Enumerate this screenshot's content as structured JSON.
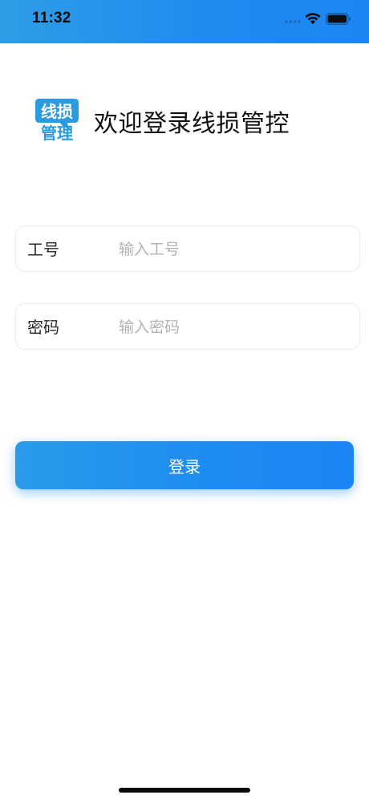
{
  "status_bar": {
    "time": "11:32",
    "background_color": "#1f8af0"
  },
  "header": {
    "logo": {
      "line1": "线损",
      "line2": "管理",
      "color": "#2a9be0"
    },
    "title": "欢迎登录线损管控"
  },
  "form": {
    "employee_id": {
      "label": "工号",
      "placeholder": "输入工号",
      "value": ""
    },
    "password": {
      "label": "密码",
      "placeholder": "输入密码",
      "value": ""
    }
  },
  "login_button": {
    "label": "登录",
    "color": "#1f8cf1"
  },
  "icons": {
    "signal": "cellular-signal-icon",
    "wifi": "wifi-icon",
    "battery": "battery-icon"
  }
}
